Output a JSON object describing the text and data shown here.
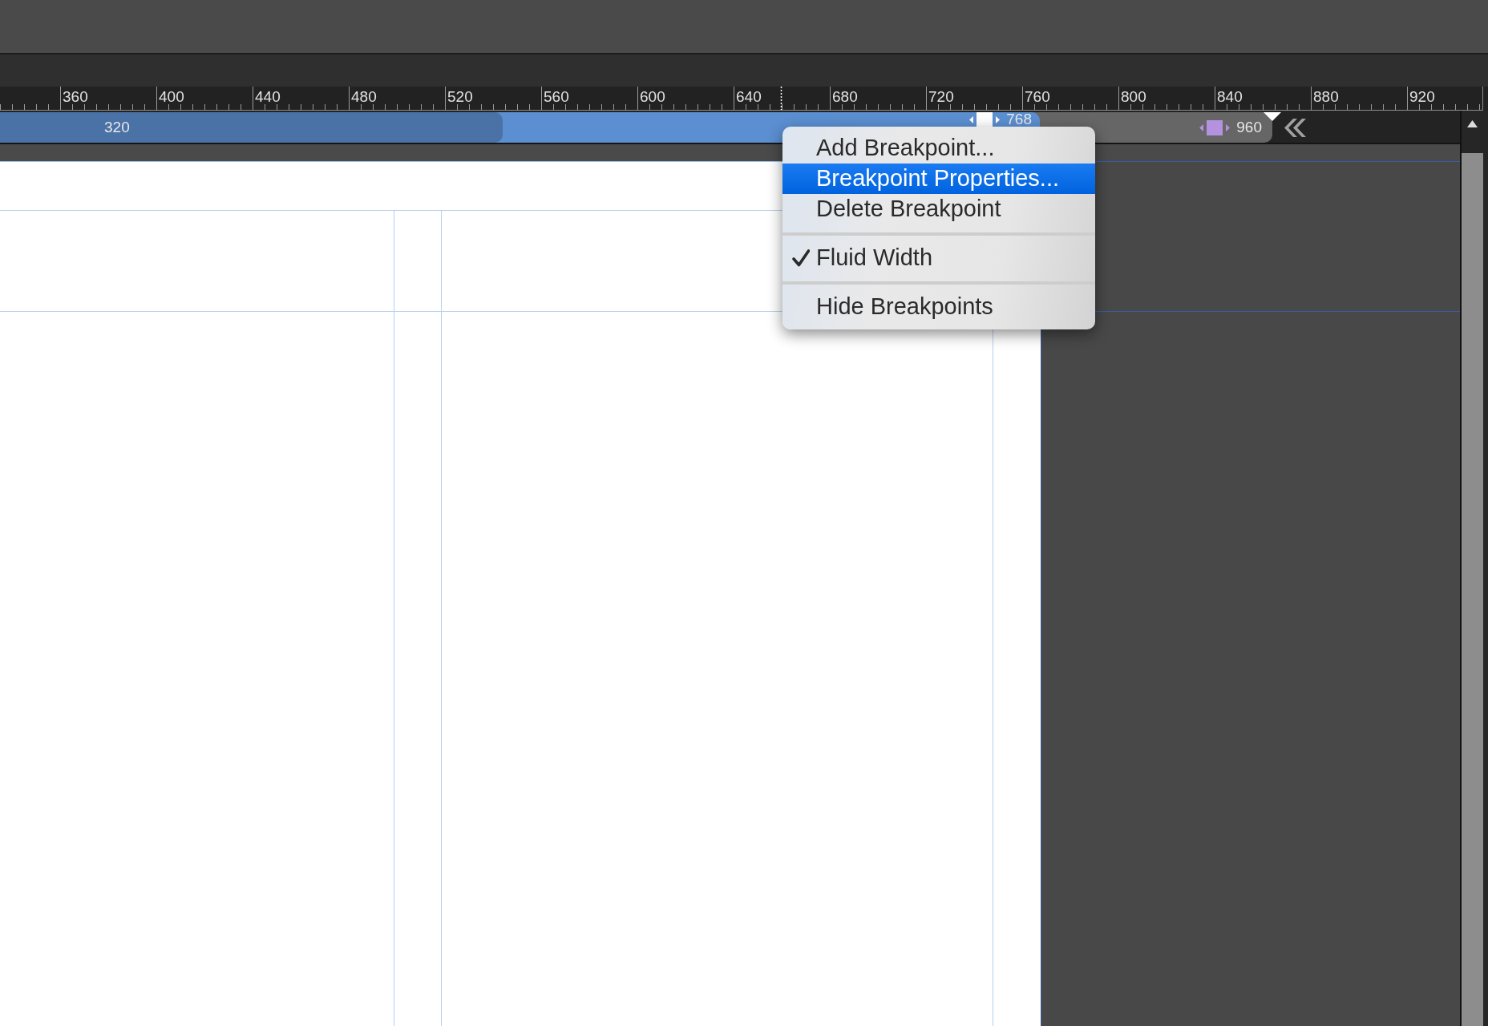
{
  "ruler": {
    "labels": [
      "360",
      "400",
      "440",
      "480",
      "520",
      "560",
      "600",
      "640",
      "680",
      "720",
      "760",
      "800",
      "840",
      "880",
      "920"
    ]
  },
  "breakpoints": [
    {
      "label": "320",
      "color": "#4a72a6"
    },
    {
      "label": "768",
      "color": "#5b8fd1",
      "marker": {
        "color": "#ffffff"
      }
    },
    {
      "label": "960",
      "color": "#666666",
      "marker": {
        "color": "#b592e0"
      }
    }
  ],
  "context_menu": {
    "items": [
      {
        "kind": "item",
        "label": "Add Breakpoint...",
        "selected": false
      },
      {
        "kind": "item",
        "label": "Breakpoint Properties...",
        "selected": true
      },
      {
        "kind": "item",
        "label": "Delete Breakpoint",
        "selected": false
      },
      {
        "kind": "separator"
      },
      {
        "kind": "toggle",
        "label": "Fluid Width",
        "checked": true,
        "selected": false
      },
      {
        "kind": "separator"
      },
      {
        "kind": "item",
        "label": "Hide Breakpoints",
        "selected": false
      }
    ]
  }
}
